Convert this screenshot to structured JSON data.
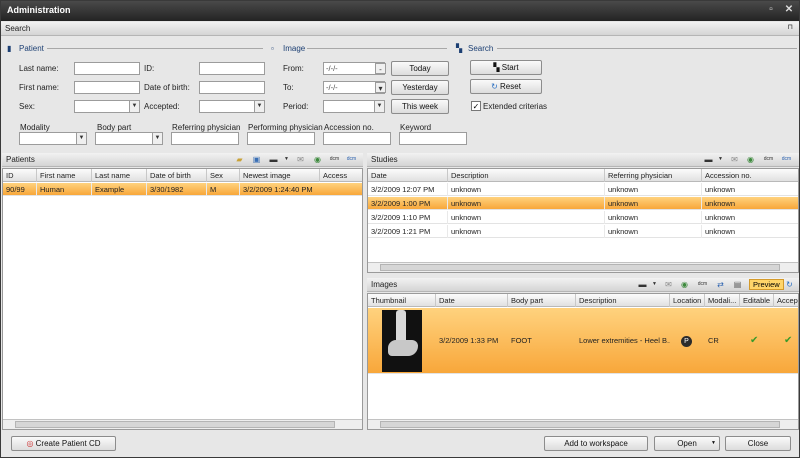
{
  "window": {
    "title": "Administration"
  },
  "search": {
    "title": "Search",
    "patient_section": "Patient",
    "image_section": "Image",
    "search_section": "Search",
    "last_name": "Last name:",
    "id": "ID:",
    "first_name": "First name:",
    "dob": "Date of birth:",
    "sex": "Sex:",
    "accepted": "Accepted:",
    "from": "From:",
    "to": "To:",
    "period": "Period:",
    "from_value": "-/-/-",
    "to_value": "-/-/-",
    "today": "Today",
    "yesterday": "Yesterday",
    "this_week": "This week",
    "start": "Start",
    "reset": "Reset",
    "extended": "Extended criterias",
    "modality": "Modality",
    "body_part": "Body part",
    "referring": "Referring physician",
    "performing": "Performing physician",
    "accession": "Accession no.",
    "keyword": "Keyword"
  },
  "patients": {
    "title": "Patients",
    "columns": [
      "ID",
      "First name",
      "Last name",
      "Date of birth",
      "Sex",
      "Newest image",
      "Access"
    ],
    "rows": [
      [
        "90/99",
        "Human",
        "Example",
        "3/30/1982",
        "M",
        "3/2/2009 1:24:40 PM",
        ""
      ]
    ]
  },
  "studies": {
    "title": "Studies",
    "columns": [
      "Date",
      "Description",
      "Referring physician",
      "Accession no."
    ],
    "rows": [
      [
        "3/2/2009 12:07 PM",
        "unknown",
        "unknown",
        "unknown"
      ],
      [
        "3/2/2009 1:00 PM",
        "unknown",
        "unknown",
        "unknown"
      ],
      [
        "3/2/2009 1:10 PM",
        "unknown",
        "unknown",
        "unknown"
      ],
      [
        "3/2/2009 1:21 PM",
        "unknown",
        "unknown",
        "unknown"
      ]
    ]
  },
  "images": {
    "title": "Images",
    "preview": "Preview",
    "columns": [
      "Thumbnail",
      "Date",
      "Body part",
      "Description",
      "Location",
      "Modali...",
      "Editable",
      "Accepted"
    ],
    "rows": [
      [
        "",
        "3/2/2009 1:33 PM",
        "FOOT",
        "Lower extremities - Heel B...",
        "",
        "CR",
        "",
        ""
      ]
    ]
  },
  "footer": {
    "create_patient": "Create Patient CD",
    "add_workspace": "Add to workspace",
    "open": "Open",
    "close": "Close"
  },
  "icons": {
    "dcm": "dcm"
  }
}
